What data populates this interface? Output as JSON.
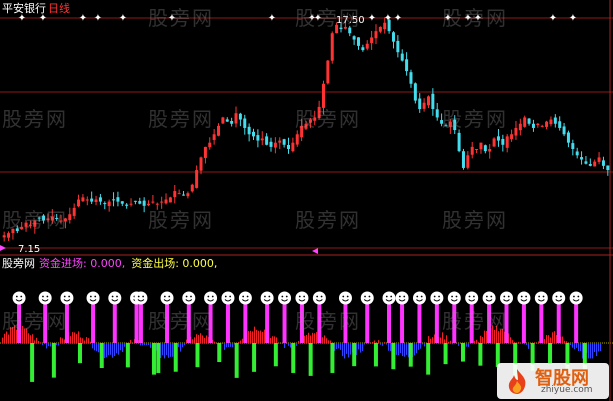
{
  "header": {
    "stock_name": "平安银行",
    "period": "日线",
    "indicator_name": "股旁网",
    "fund_in_label": "资金进场: 0.000,",
    "fund_out_label": "资金出场: 0.000,"
  },
  "price_annotations": {
    "high_label": "17.50",
    "low_label": "7.15"
  },
  "watermark": "股旁网",
  "logo": {
    "title": "智股网",
    "subtitle": "zhiyue.com"
  },
  "colors": {
    "background": "#000000",
    "up_candle": "#ff3333",
    "down_candle": "#44ddee",
    "grid": "#8b1a1a",
    "fund_in_bar": "#ff33ff",
    "fund_out_bar": "#33ee33",
    "hist_red": "#ee2222",
    "hist_blue": "#3344ff"
  },
  "icons": {
    "signal_marker": "smiley-face-icon",
    "top_marker": "star-marker-icon"
  },
  "chart_data": [
    {
      "type": "candlestick",
      "title": "平安银行 日线",
      "ylim": [
        6.5,
        18.0
      ],
      "price_extremes": {
        "high": 17.5,
        "low": 7.15
      },
      "close": [
        7.2,
        7.3,
        7.5,
        7.4,
        7.6,
        7.8,
        7.7,
        7.9,
        8.0,
        7.9,
        8.0,
        8.1,
        8.0,
        7.9,
        8.0,
        8.2,
        8.5,
        8.9,
        9.0,
        8.9,
        8.8,
        8.9,
        8.8,
        8.7,
        8.8,
        8.9,
        8.8,
        8.7,
        8.6,
        8.7,
        8.8,
        8.7,
        8.6,
        8.7,
        8.8,
        8.7,
        8.8,
        8.9,
        9.0,
        9.3,
        9.2,
        9.1,
        9.2,
        9.6,
        10.3,
        10.9,
        11.4,
        11.6,
        12.0,
        12.4,
        12.8,
        12.6,
        12.5,
        13.0,
        12.7,
        12.3,
        12.0,
        11.9,
        11.7,
        11.8,
        11.5,
        11.4,
        11.6,
        11.7,
        11.5,
        11.3,
        11.6,
        12.0,
        12.4,
        12.5,
        12.7,
        12.8,
        13.3,
        14.4,
        15.5,
        16.8,
        17.2,
        17.0,
        17.1,
        16.8,
        16.5,
        16.2,
        16.0,
        16.3,
        16.6,
        16.9,
        17.1,
        17.3,
        16.9,
        16.4,
        15.9,
        15.5,
        15.0,
        14.4,
        13.6,
        13.2,
        13.5,
        13.8,
        13.2,
        12.8,
        12.5,
        12.4,
        12.6,
        12.2,
        11.2,
        10.4,
        11.0,
        11.4,
        11.3,
        11.6,
        11.2,
        11.3,
        11.8,
        11.7,
        11.5,
        11.9,
        12.0,
        12.3,
        12.5,
        12.8,
        12.5,
        12.3,
        12.5,
        12.4,
        12.6,
        12.7,
        12.5,
        12.3,
        12.0,
        11.6,
        11.3,
        11.0,
        10.8,
        10.6,
        10.5,
        10.7,
        10.9,
        10.5,
        10.3
      ],
      "annotations": [
        "17.50",
        "7.15"
      ]
    },
    {
      "type": "bar",
      "title": "股旁网",
      "series": [
        {
          "name": "资金进场",
          "latest": 0.0,
          "signal_days": [
            3,
            9,
            14,
            20,
            25,
            30,
            31,
            37,
            42,
            47,
            51,
            55,
            60,
            64,
            68,
            72,
            78,
            83,
            88,
            91,
            95,
            99,
            103,
            107,
            111,
            115,
            119,
            123,
            127,
            131
          ]
        },
        {
          "name": "资金出场",
          "latest": 0.0,
          "signal_days": [
            6,
            11,
            17,
            22,
            28,
            34,
            35,
            39,
            44,
            49,
            53,
            57,
            62,
            66,
            70,
            75,
            80,
            85,
            89,
            93,
            97,
            101,
            105,
            109,
            113,
            117,
            121,
            125,
            129,
            133
          ]
        }
      ]
    }
  ]
}
